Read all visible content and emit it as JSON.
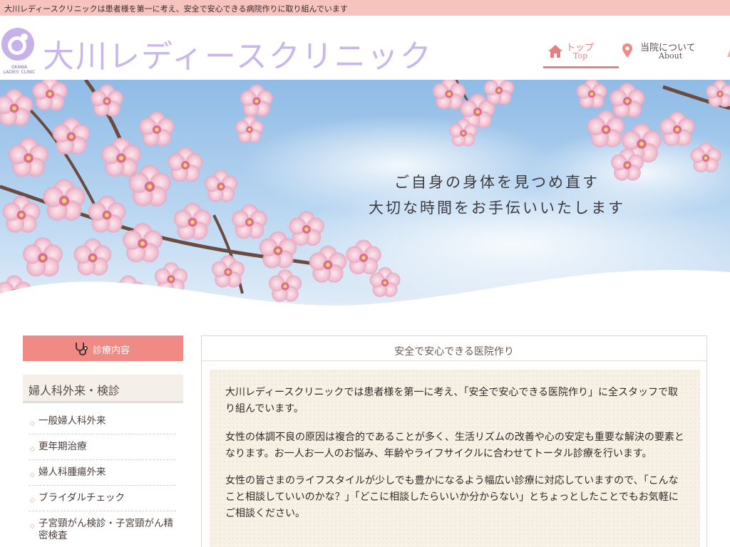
{
  "topbar": {
    "text": "大川レディースクリニックは患者様を第一に考え、安全で安心できる病院作りに取り組んでいます"
  },
  "header": {
    "logo_sub_line1": "OKAWA",
    "logo_sub_line2": "LADIES' CLINIC",
    "site_title": "大川レディースクリニック"
  },
  "nav": {
    "items": [
      {
        "jp": "トップ",
        "en": "Top",
        "icon": "home-icon",
        "active": true
      },
      {
        "jp": "当院について",
        "en": "About",
        "icon": "location-pin-icon",
        "active": false
      }
    ]
  },
  "hero": {
    "line1": "ご自身の身体を見つめ直す",
    "line2": "大切な時間をお手伝いいたします"
  },
  "sidebar": {
    "button_label": "診療内容",
    "button_icon": "stethoscope-icon",
    "heading": "婦人科外来・検診",
    "items": [
      "一般婦人科外来",
      "更年期治療",
      "婦人科腫瘍外来",
      "ブライダルチェック",
      "子宮頸がん検診・子宮頸がん精密検査"
    ]
  },
  "main": {
    "title": "安全で安心できる医院作り",
    "paragraphs": [
      "大川レディースクリニックでは患者様を第一に考え、「安全で安心できる医院作り」に全スタッフで取り組んでいます。",
      "女性の体調不良の原因は複合的であることが多く、生活リズムの改善や心の安定も重要な解決の要素となります。お一人お一人のお悩み、年齢やライフサイクルに合わせてトータル診療を行います。",
      "女性の皆さまのライフスタイルが少しでも豊かになるよう幅広い診療に対応していますので、「こんなこと相談していいのかな？」「どこに相談したらいいか分からない」とちょっとしたことでもお気軽にご相談ください。"
    ]
  },
  "colors": {
    "topbar_bg": "#f7c3bf",
    "accent": "#ef8a84",
    "title_lavender": "#c9b7ea",
    "sky": "#9fc6ea"
  }
}
